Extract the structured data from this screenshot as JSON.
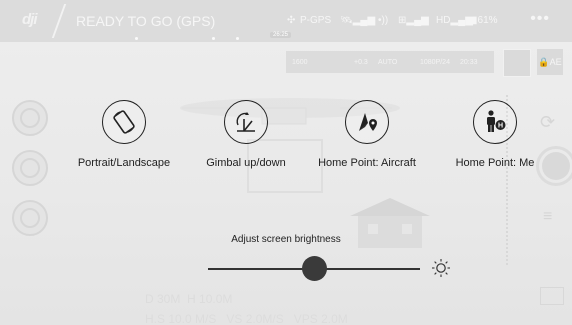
{
  "status_bar": {
    "logo": "dji",
    "status": "READY TO GO (GPS)",
    "gps_mode": "P-GPS",
    "battery": "61%",
    "hd": "HD",
    "time_chip": "26:25"
  },
  "camera_params": {
    "iso": "1600",
    "ev": "+0.3",
    "wb": "AUTO",
    "format": "1080P/24",
    "remaining": "20:33"
  },
  "ae_label": "AE",
  "actions": [
    {
      "label": "Portrait/Landscape"
    },
    {
      "label": "Gimbal up/down"
    },
    {
      "label": "Home Point: Aircraft"
    },
    {
      "label": "Home Point: Me"
    }
  ],
  "brightness": {
    "label": "Adjust screen brightness",
    "level": 0.5
  },
  "telemetry": {
    "d": "D 30M",
    "h": "H 10.0M",
    "hs": "H.S 10.0 M/S",
    "vs": "VS 2.0M/S",
    "vps": "VPS 2.0M"
  }
}
